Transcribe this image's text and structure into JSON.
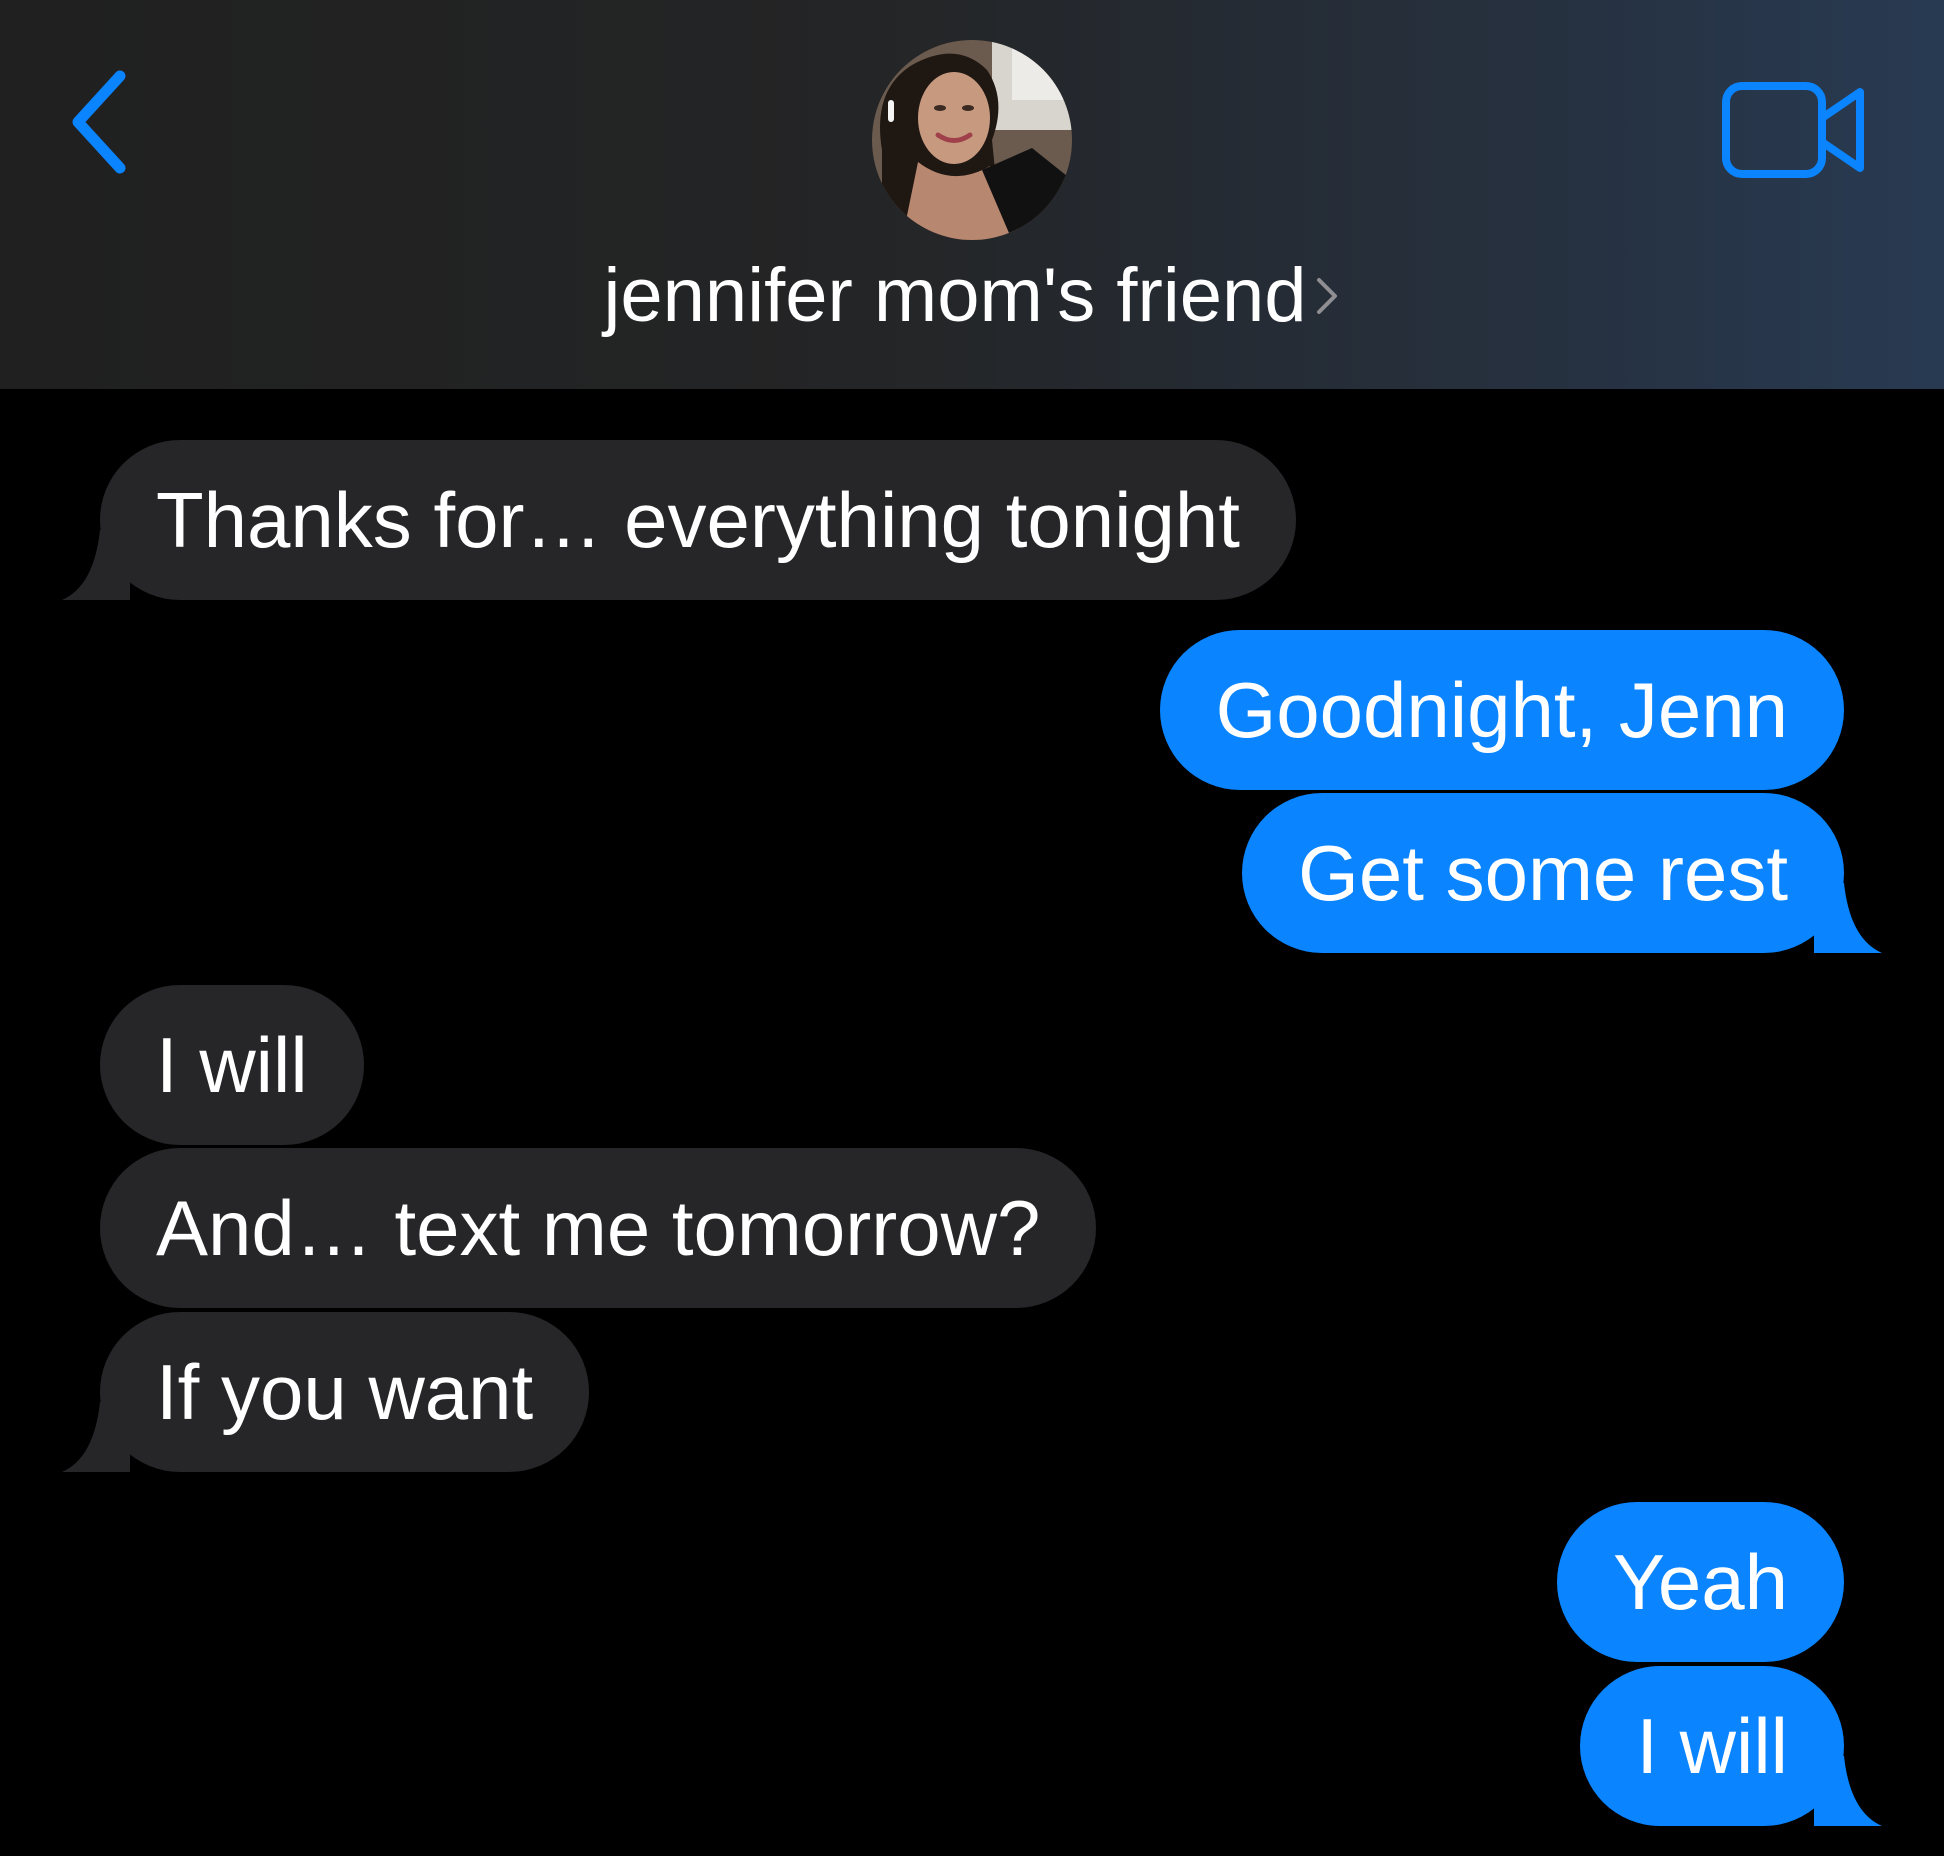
{
  "header": {
    "contact_name": "jennifer mom's friend",
    "back_icon": "chevron-left-icon",
    "info_chevron_icon": "chevron-right-icon",
    "video_icon": "video-camera-icon",
    "avatar": "contact-photo"
  },
  "colors": {
    "accent": "#0a84ff",
    "received_bubble": "#262628",
    "background": "#000000",
    "header_bg": "#242526"
  },
  "messages": [
    {
      "direction": "received",
      "text": "Thanks for… everything tonight"
    },
    {
      "direction": "sent",
      "text": "Goodnight, Jenn"
    },
    {
      "direction": "sent",
      "text": "Get some rest"
    },
    {
      "direction": "received",
      "text": "I will"
    },
    {
      "direction": "received",
      "text": "And… text me tomorrow?"
    },
    {
      "direction": "received",
      "text": "If you want"
    },
    {
      "direction": "sent",
      "text": "Yeah"
    },
    {
      "direction": "sent",
      "text": "I will"
    }
  ]
}
